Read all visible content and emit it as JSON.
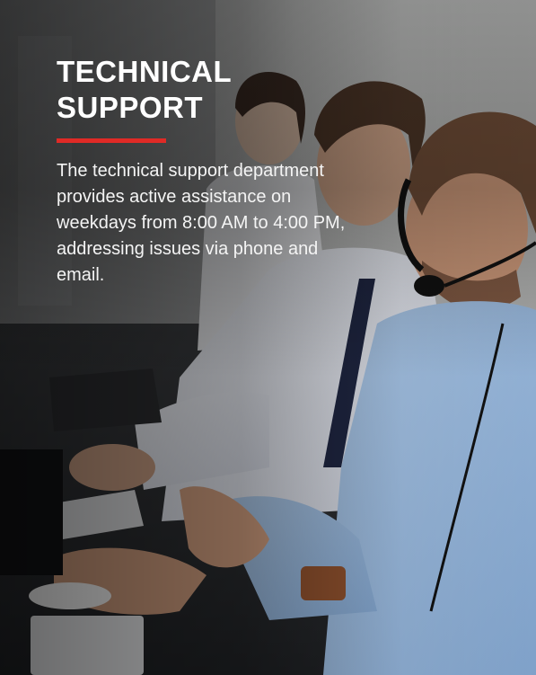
{
  "card": {
    "title_line1": "TECHNICAL",
    "title_line2": "SUPPORT",
    "description": "The technical support department\nprovides active assistance on\nweekdays from 8:00 AM to 4:00 PM,\naddressing issues via phone and\nemail.",
    "accent_color": "#e02a26",
    "photo_icon": "call-center-agents-photo"
  }
}
